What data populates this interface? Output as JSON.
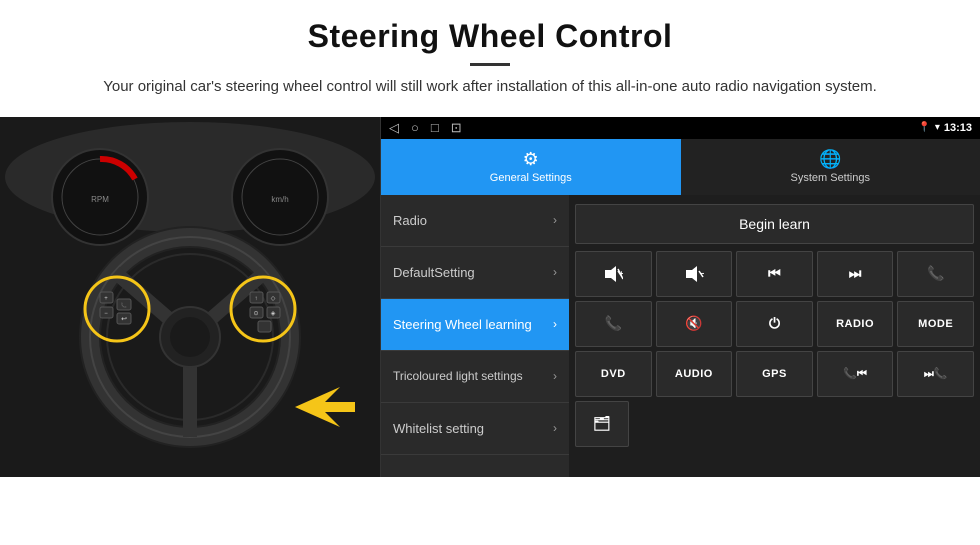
{
  "header": {
    "title": "Steering Wheel Control",
    "subtitle": "Your original car's steering wheel control will still work after installation of this all-in-one auto radio navigation system."
  },
  "status_bar": {
    "time": "13:13",
    "nav_icons": [
      "◁",
      "○",
      "□",
      "⊡"
    ]
  },
  "tabs": [
    {
      "id": "general",
      "label": "General Settings",
      "active": true
    },
    {
      "id": "system",
      "label": "System Settings",
      "active": false
    }
  ],
  "menu_items": [
    {
      "id": "radio",
      "label": "Radio",
      "active": false
    },
    {
      "id": "default",
      "label": "DefaultSetting",
      "active": false
    },
    {
      "id": "steering",
      "label": "Steering Wheel learning",
      "active": true
    },
    {
      "id": "tricoloured",
      "label": "Tricoloured light settings",
      "active": false
    },
    {
      "id": "whitelist",
      "label": "Whitelist setting",
      "active": false
    }
  ],
  "controls": {
    "begin_learn_label": "Begin learn",
    "row1": [
      "🔊+",
      "🔊−",
      "⏮",
      "⏭",
      "📞"
    ],
    "row2": [
      "📞",
      "🔇",
      "⏻",
      "RADIO",
      "MODE"
    ],
    "row3": [
      "DVD",
      "AUDIO",
      "GPS",
      "📞⏮",
      "⏭📞"
    ],
    "row4": [
      "🗂"
    ]
  }
}
